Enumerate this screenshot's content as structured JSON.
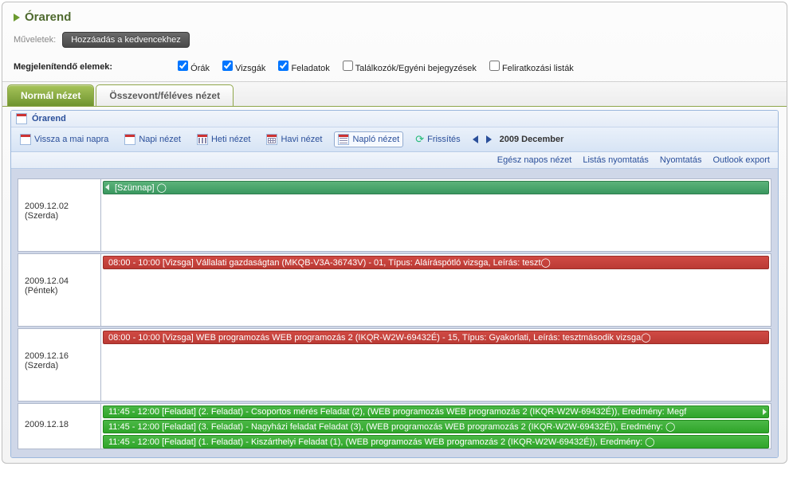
{
  "header": {
    "title": "Órarend"
  },
  "ops": {
    "label": "Műveletek:",
    "fav_btn": "Hozzáadás a kedvencekhez"
  },
  "filters": {
    "label": "Megjelenítendő elemek:",
    "items": [
      {
        "label": "Órák",
        "checked": true
      },
      {
        "label": "Vizsgák",
        "checked": true
      },
      {
        "label": "Feladatok",
        "checked": true
      },
      {
        "label": "Találkozók/Egyéni bejegyzések",
        "checked": false
      },
      {
        "label": "Feliratkozási listák",
        "checked": false
      }
    ]
  },
  "tabs": {
    "active": "Normál nézet",
    "inactive": "Összevont/féléves nézet"
  },
  "cal": {
    "title": "Órarend",
    "today": "Vissza a mai napra",
    "day": "Napi nézet",
    "week": "Heti nézet",
    "month": "Havi nézet",
    "log": "Napló nézet",
    "refresh": "Frissítés",
    "range": "2009 December",
    "allday": "Egész napos nézet",
    "listprint": "Listás nyomtatás",
    "print": "Nyomtatás",
    "outlook": "Outlook export"
  },
  "days": [
    {
      "date": "2009.12.02",
      "dow": "(Szerda)",
      "events": [
        {
          "kind": "green",
          "text": "[Szünnap] ◯",
          "left_nub": true
        }
      ]
    },
    {
      "date": "2009.12.04",
      "dow": "(Péntek)",
      "events": [
        {
          "kind": "red",
          "text": "08:00 - 10:00 [Vizsga] Vállalati gazdaságtan (MKQB-V3A-36743V) - 01, Típus: Aláíráspótló vizsga, Leírás: teszt◯"
        }
      ]
    },
    {
      "date": "2009.12.16",
      "dow": "(Szerda)",
      "events": [
        {
          "kind": "red",
          "text": "08:00 - 10:00 [Vizsga] WEB programozás WEB programozás 2 (IKQR-W2W-69432É) - 15, Típus: Gyakorlati, Leírás: tesztmásodik vizsga◯"
        }
      ]
    },
    {
      "date": "2009.12.18",
      "dow": "",
      "events": [
        {
          "kind": "grn2",
          "text": "11:45 - 12:00 [Feladat] (2. Feladat) - Csoportos mérés Feladat (2), (WEB programozás WEB programozás 2 (IKQR-W2W-69432É)), Eredmény: Megf",
          "right_nub": true
        },
        {
          "kind": "grn2",
          "text": "11:45 - 12:00 [Feladat] (3. Feladat) - Nagyházi feladat Feladat (3), (WEB programozás WEB programozás 2 (IKQR-W2W-69432É)), Eredmény: ◯"
        },
        {
          "kind": "grn2",
          "text": "11:45 - 12:00 [Feladat] (1. Feladat) - Kiszárthelyi Feladat (1), (WEB programozás WEB programozás 2 (IKQR-W2W-69432É)), Eredmény: ◯"
        }
      ]
    }
  ]
}
